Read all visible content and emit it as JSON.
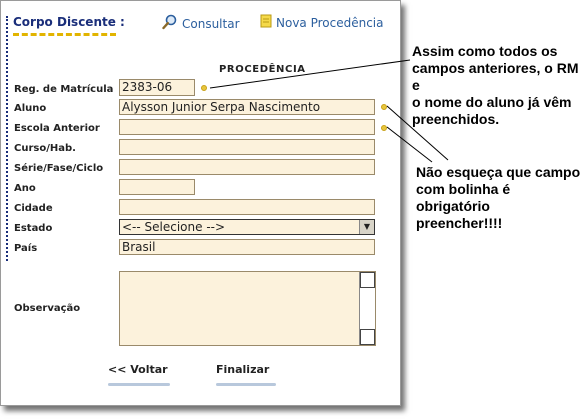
{
  "header": {
    "title": "Corpo Discente :"
  },
  "nav": {
    "consultar": "Consultar",
    "nova_procedencia": "Nova Procedência"
  },
  "section_title": "PROCEDÊNCIA",
  "fields": {
    "reg_matricula": {
      "label": "Reg. de Matrícula",
      "value": "2383-06"
    },
    "aluno": {
      "label": "Aluno",
      "value": "Alysson Junior Serpa Nascimento"
    },
    "escola_anterior": {
      "label": "Escola Anterior",
      "value": ""
    },
    "curso": {
      "label": "Curso/Hab.",
      "value": ""
    },
    "serie": {
      "label": "Série/Fase/Ciclo",
      "value": ""
    },
    "ano": {
      "label": "Ano",
      "value": ""
    },
    "cidade": {
      "label": "Cidade",
      "value": ""
    },
    "estado": {
      "label": "Estado",
      "value": "<-- Selecione -->"
    },
    "pais": {
      "label": "País",
      "value": "Brasil"
    },
    "observacao": {
      "label": "Observação",
      "value": ""
    }
  },
  "buttons": {
    "voltar": "<< Voltar",
    "finalizar": "Finalizar"
  },
  "annotations": {
    "note1": [
      "Assim como todos os",
      "campos anteriores, o RM e",
      "o nome do aluno já vêm",
      "preenchidos."
    ],
    "note2": [
      "Não esqueça que campo",
      "com bolinha é obrigatório",
      "preencher!!!!"
    ]
  },
  "colors": {
    "field_bg": "#fcf2dc",
    "header_text": "#1a2e7a",
    "link": "#2c5f9e",
    "required_dot": "#e8c63c",
    "header_underline": "#e2b400"
  }
}
